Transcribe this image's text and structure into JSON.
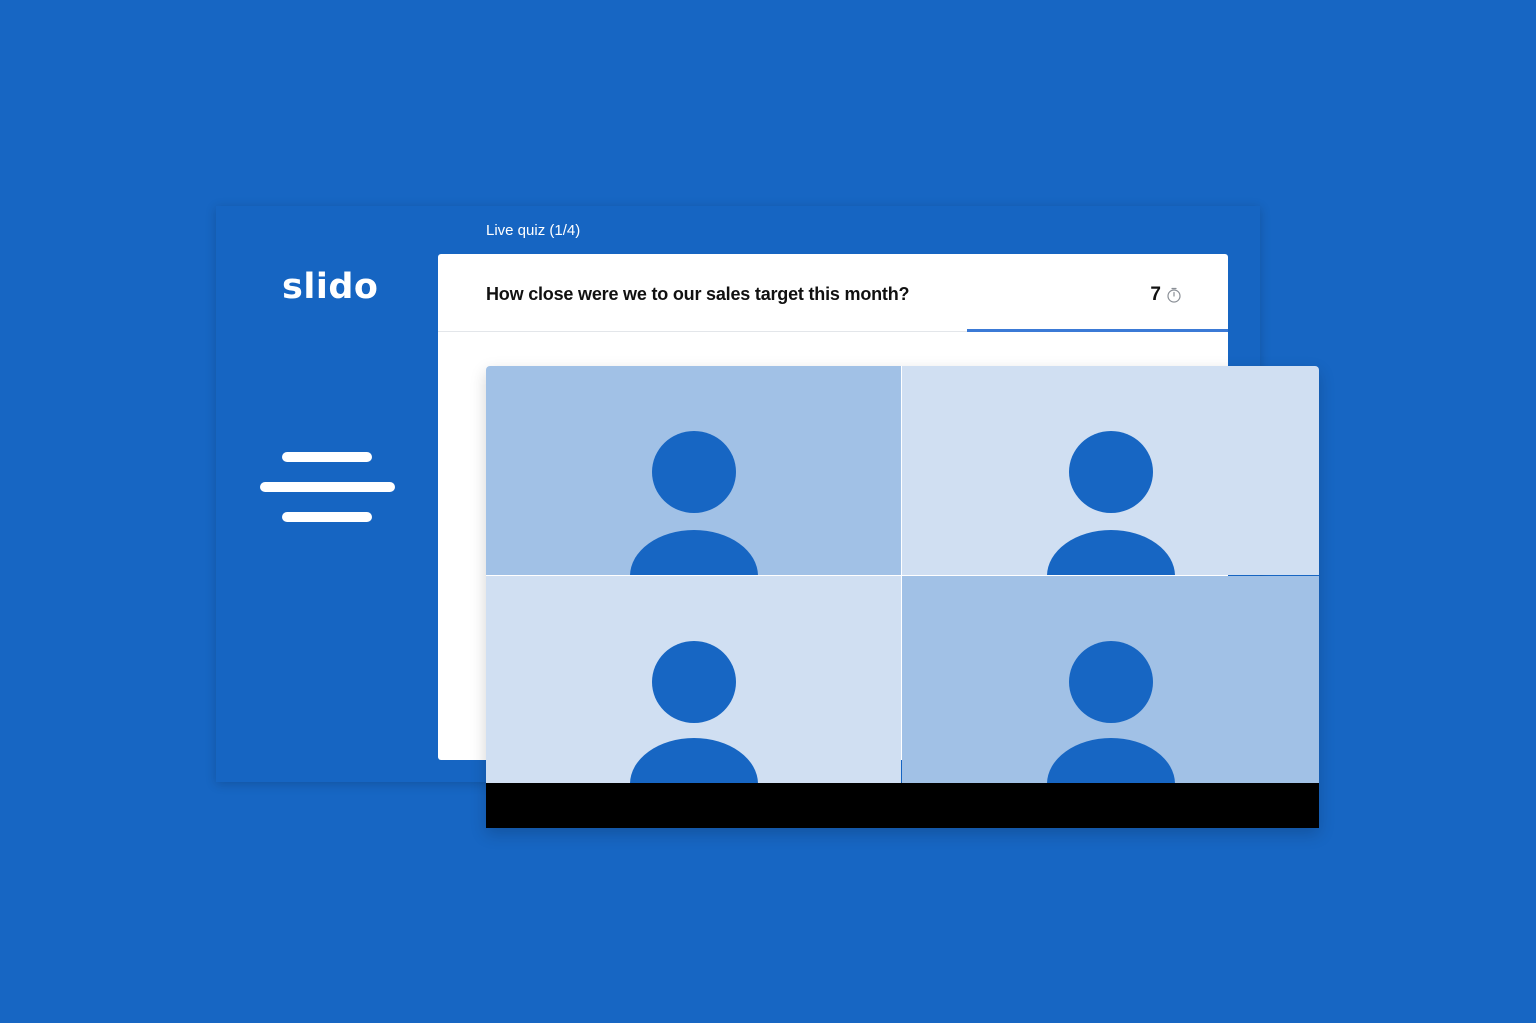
{
  "colors": {
    "background": "#1766c3",
    "panel": "#1665c2",
    "card": "#ffffff",
    "accent": "#3b7ad6",
    "tile_dark": "#a1c1e6",
    "tile_light": "#d0dff2",
    "avatar": "#1766c3",
    "toolbar": "#000000"
  },
  "brand": {
    "logo_text": "slido"
  },
  "sidebar": {
    "menu_icon": "hamburger-menu-icon"
  },
  "quiz": {
    "label": "Live quiz (1/4)",
    "question": "How close were we to our sales target this month?",
    "timer_value": "7",
    "timer_icon": "stopwatch-icon",
    "progress_fraction": 0.33
  },
  "video_call": {
    "participants": [
      {
        "tile_color": "#a1c1e6",
        "icon": "person-avatar-icon"
      },
      {
        "tile_color": "#d0dff2",
        "icon": "person-avatar-icon"
      },
      {
        "tile_color": "#d0dff2",
        "icon": "person-avatar-icon"
      },
      {
        "tile_color": "#a1c1e6",
        "icon": "person-avatar-icon"
      }
    ]
  }
}
